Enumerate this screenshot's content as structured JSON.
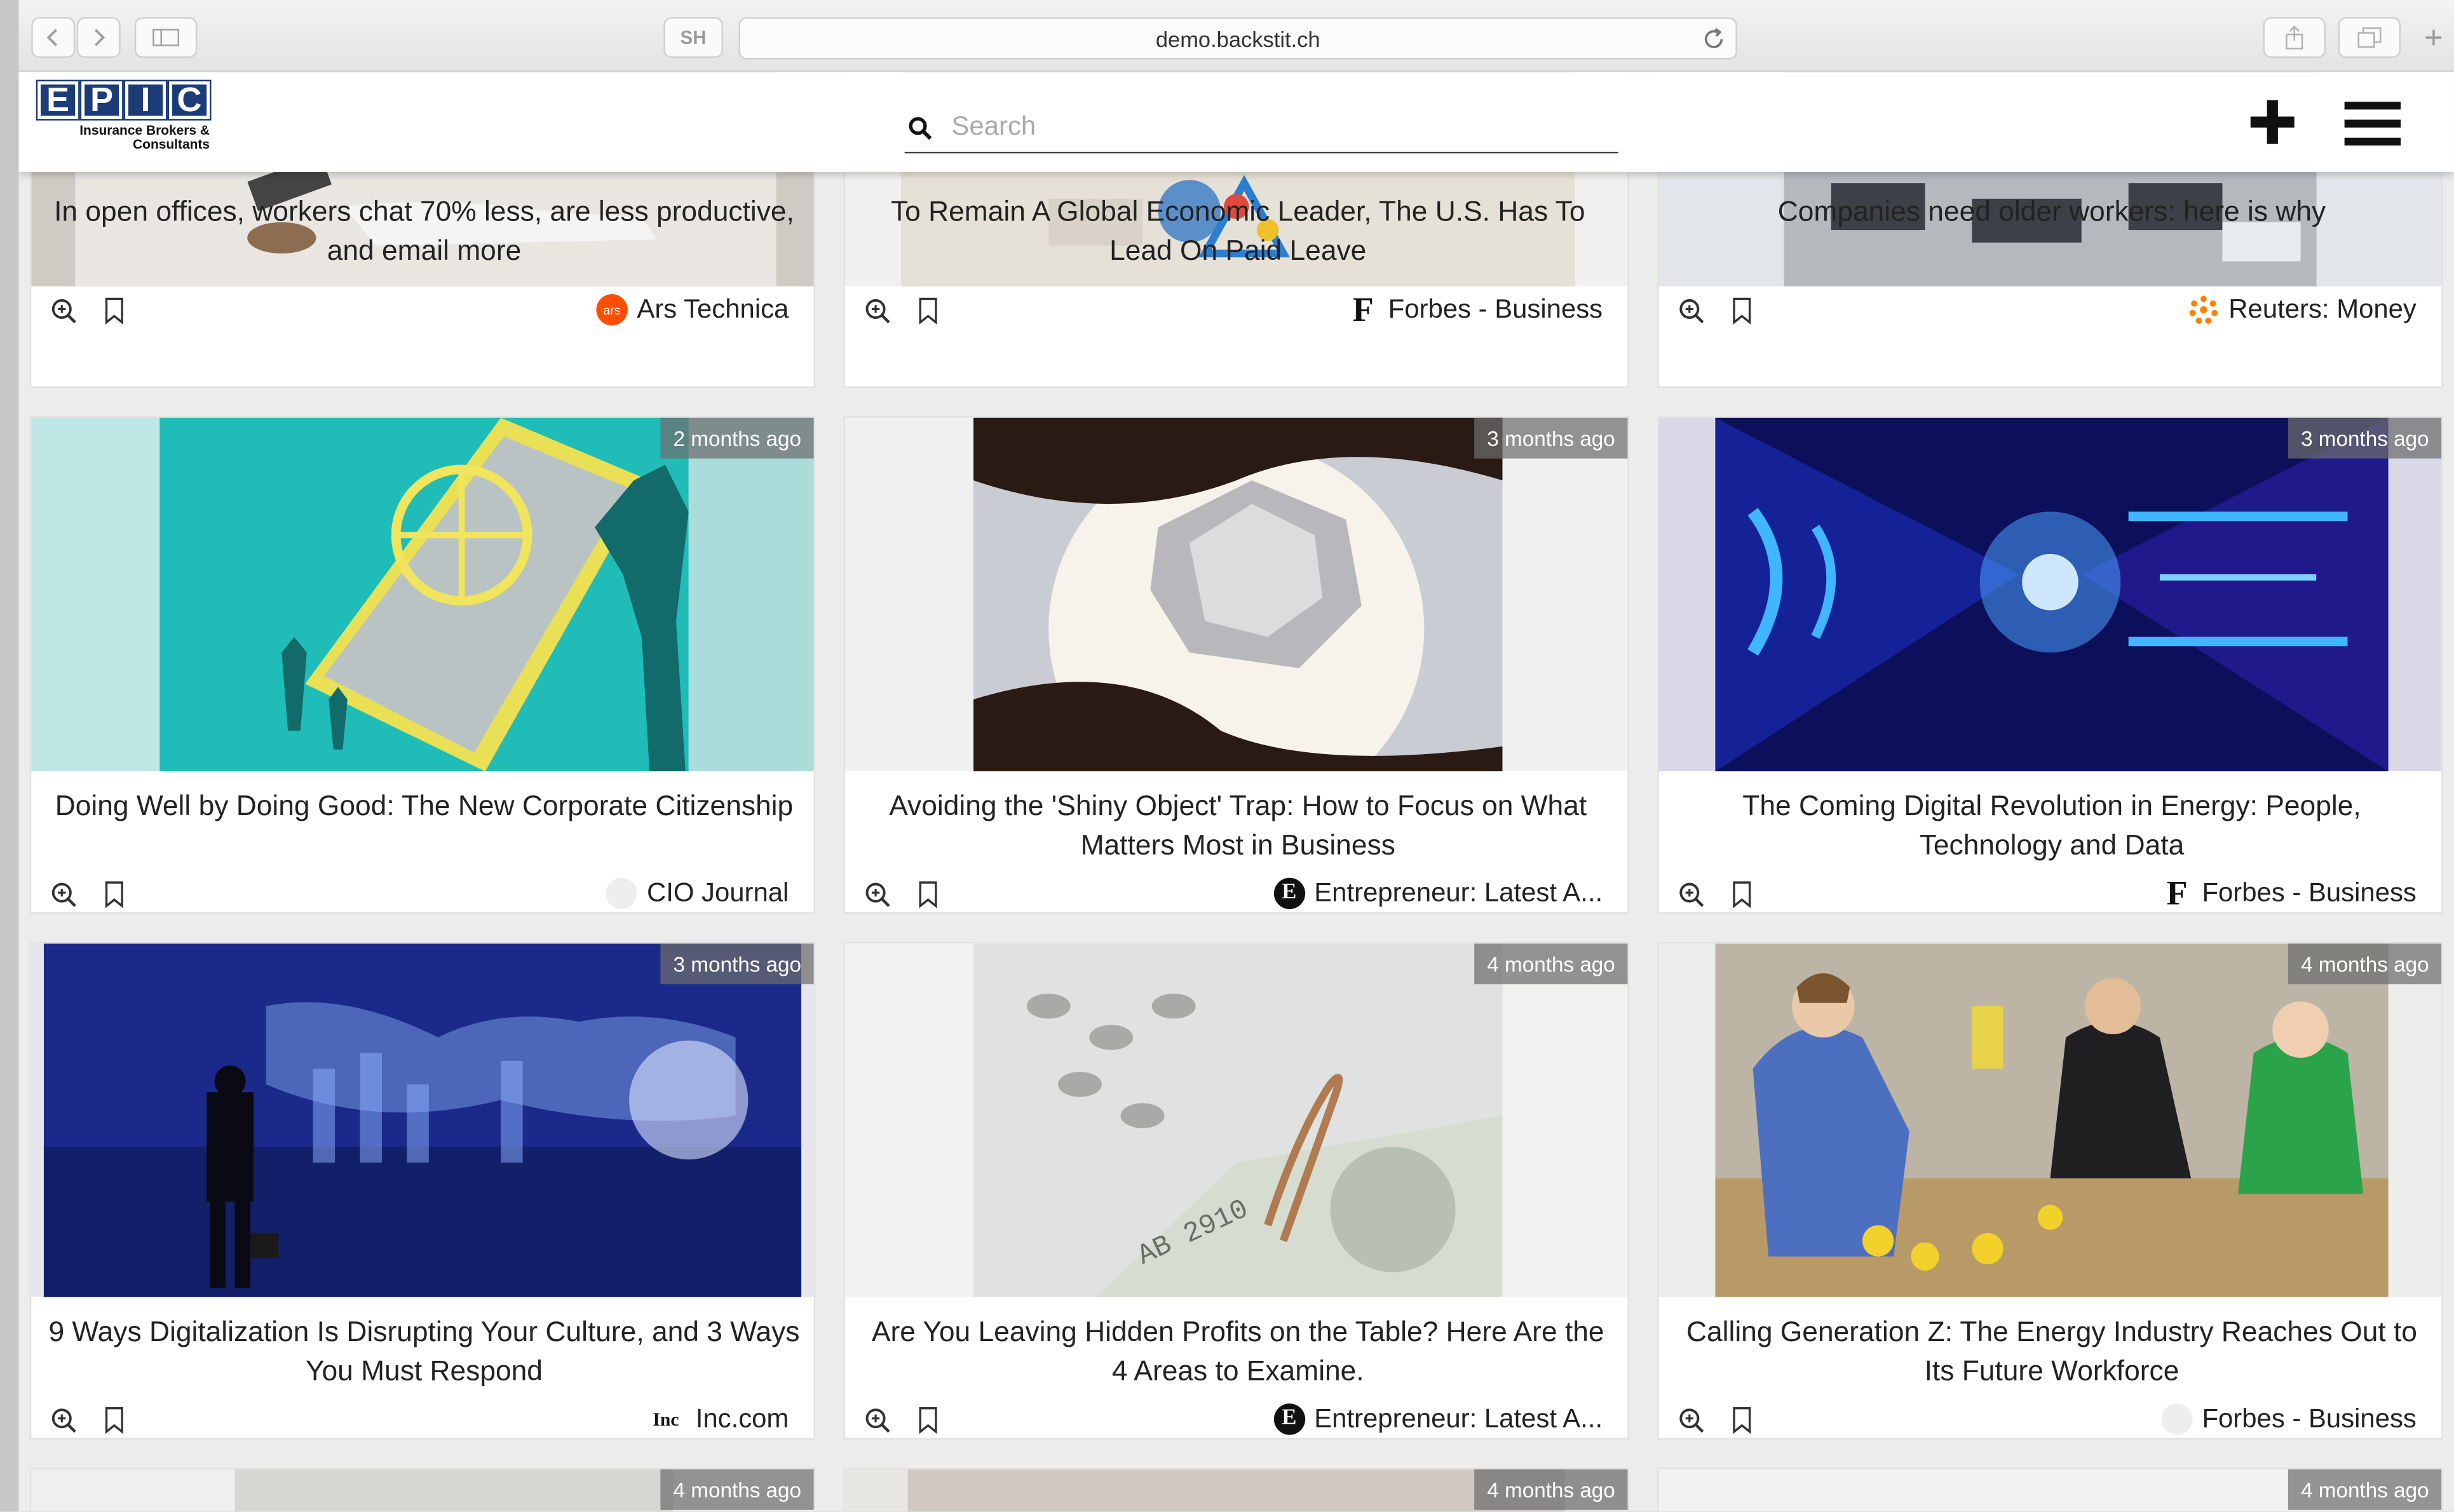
{
  "browser": {
    "url": "demo.backstit.ch",
    "tab_label": "SH"
  },
  "header": {
    "logo_letters": [
      "E",
      "P",
      "I",
      "C"
    ],
    "logo_line1": "Insurance Brokers &",
    "logo_line2": "Consultants",
    "search_placeholder": "Search"
  },
  "cards": [
    {
      "title": "In open offices, workers chat 70% less, are less productive, and email more",
      "source": "Ars Technica",
      "age": ""
    },
    {
      "title": "To Remain A Global Economic Leader, The U.S. Has To Lead On Paid Leave",
      "source": "Forbes - Business",
      "age": ""
    },
    {
      "title": "Companies need older workers: here is why",
      "source": "Reuters: Money",
      "age": ""
    },
    {
      "title": "Doing Well by Doing Good: The New Corporate Citizenship",
      "source": "CIO Journal",
      "age": "2 months ago"
    },
    {
      "title": "Avoiding the 'Shiny Object' Trap: How to Focus on What Matters Most in Business",
      "source": "Entrepreneur: Latest A...",
      "age": "3 months ago"
    },
    {
      "title": "The Coming Digital Revolution in Energy: People, Technology and Data",
      "source": "Forbes - Business",
      "age": "3 months ago"
    },
    {
      "title": "9 Ways Digitalization Is Disrupting Your Culture, and 3 Ways You Must Respond",
      "source": "Inc.com",
      "age": "3 months ago"
    },
    {
      "title": "Are You Leaving Hidden Profits on the Table? Here Are the 4 Areas to Examine.",
      "source": "Entrepreneur: Latest A...",
      "age": "4 months ago"
    },
    {
      "title": "Calling Generation Z: The Energy Industry Reaches Out to Its Future Workforce",
      "source": "Forbes - Business",
      "age": "4 months ago"
    },
    {
      "title": "",
      "source": "",
      "age": "4 months ago"
    },
    {
      "title": "",
      "source": "",
      "age": "4 months ago"
    },
    {
      "title": "",
      "source": "",
      "age": "4 months ago"
    }
  ],
  "source_marks": {
    "ars": "ars",
    "forbes": "F",
    "entrepreneur": "E",
    "inc": "Inc"
  },
  "colors": {
    "logo_blue": "#1c3c77",
    "ars_orange": "#ff4e00",
    "badge_bg": "#6e6e6e"
  }
}
